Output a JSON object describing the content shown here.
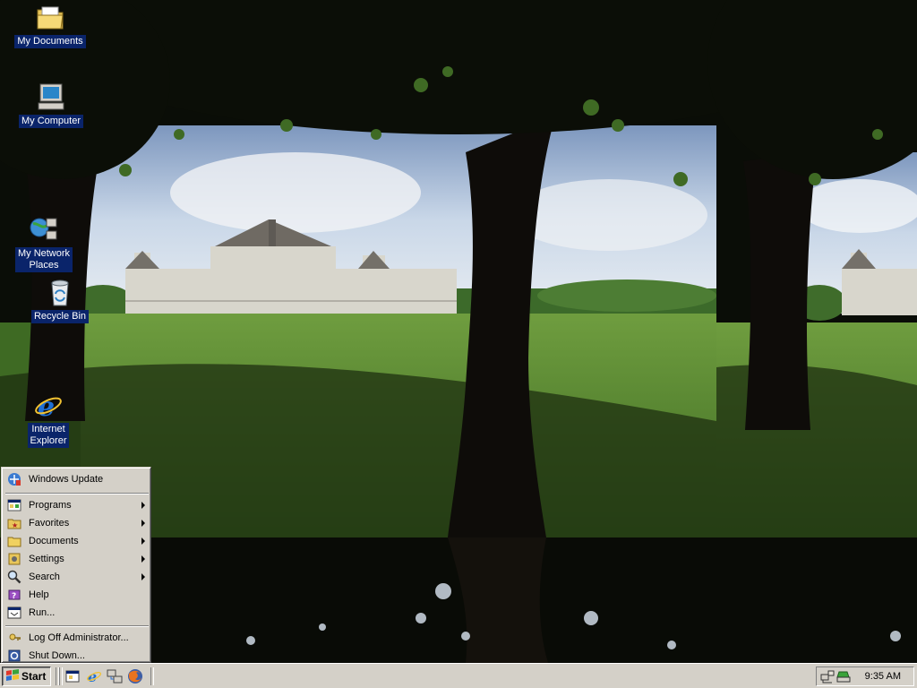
{
  "desktop": {
    "icons": [
      {
        "label": "My Documents"
      },
      {
        "label": "My Computer"
      },
      {
        "label_line1": "My Network",
        "label_line2": "Places"
      },
      {
        "label": "Recycle Bin"
      },
      {
        "label_line1": "Internet",
        "label_line2": "Explorer"
      }
    ]
  },
  "start_menu": {
    "top_item": "Windows Update",
    "items": [
      {
        "label": "Programs",
        "submenu": true,
        "icon": "programs-icon"
      },
      {
        "label": "Favorites",
        "submenu": true,
        "icon": "favorites-icon"
      },
      {
        "label": "Documents",
        "submenu": true,
        "icon": "documents-icon"
      },
      {
        "label": "Settings",
        "submenu": true,
        "icon": "settings-icon"
      },
      {
        "label": "Search",
        "submenu": true,
        "icon": "search-icon"
      },
      {
        "label": "Help",
        "submenu": false,
        "icon": "help-icon"
      },
      {
        "label": "Run...",
        "submenu": false,
        "icon": "run-icon"
      }
    ],
    "bottom_items": [
      {
        "label": "Log Off Administrator...",
        "icon": "log-off-icon"
      },
      {
        "label": "Shut Down...",
        "icon": "shut-down-icon"
      }
    ]
  },
  "taskbar": {
    "start_label": "Start",
    "quick_launch": [
      "show-desktop-icon",
      "internet-explorer-icon",
      "network-icon",
      "firefox-icon"
    ],
    "clock": "9:35 AM",
    "tray_icons": [
      "network-connection-icon",
      "printer-icon"
    ]
  },
  "colors": {
    "face": "#d4d0c8",
    "selection": "#0a246a",
    "sky": "#a9c4e2",
    "grass": "#5e8f35"
  }
}
